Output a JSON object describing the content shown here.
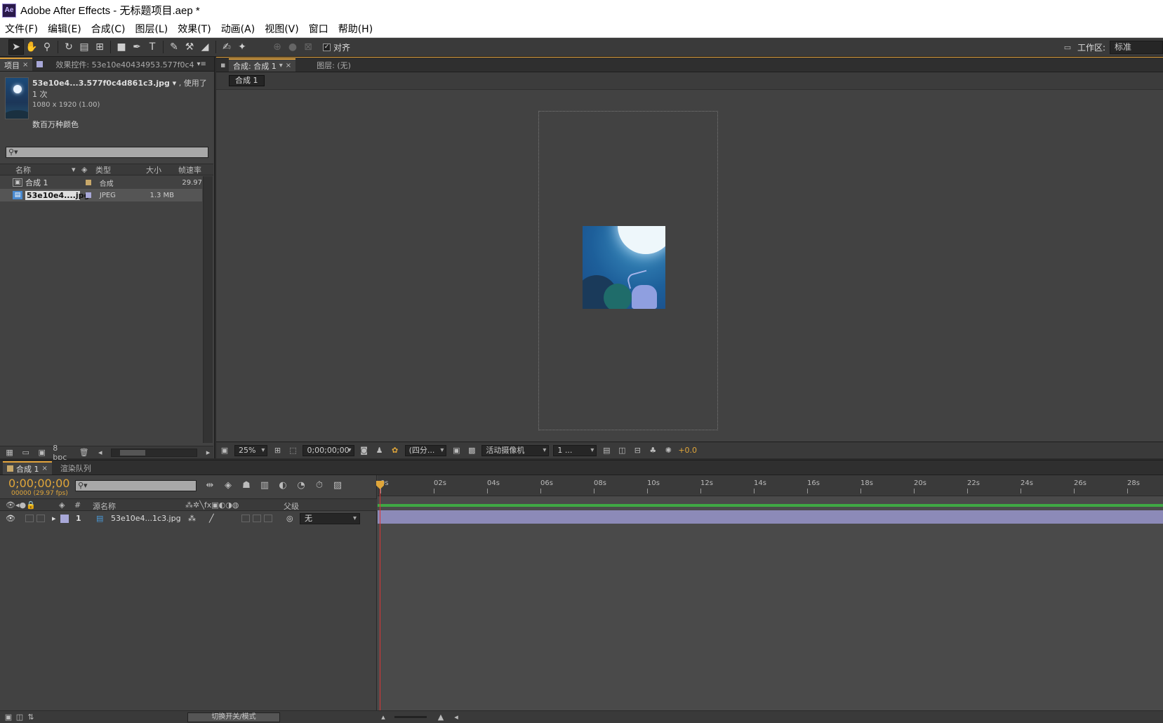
{
  "window": {
    "title": "Adobe After Effects - 无标题项目.aep *",
    "logo_text": "Ae"
  },
  "menu": [
    "文件(F)",
    "编辑(E)",
    "合成(C)",
    "图层(L)",
    "效果(T)",
    "动画(A)",
    "视图(V)",
    "窗口",
    "帮助(H)"
  ],
  "toolbar": {
    "align_label": "对齐",
    "align_checked": "✓",
    "workspace_label": "工作区:",
    "workspace_value": "标准"
  },
  "project_panel": {
    "tab_project": "项目",
    "tab_effects": "效果控件: 53e10e40434953.577f0c4",
    "file_name": "53e10e4...3.577f0c4d861c3.jpg ▾",
    "usage": ", 使用了 1 次",
    "dimensions": "1080 x 1920 (1.00)",
    "color_info": "数百万种颜色",
    "columns": {
      "name": "名称",
      "type": "类型",
      "size": "大小",
      "fps": "帧速率"
    },
    "items": [
      {
        "name": "合成 1",
        "type": "合成",
        "size": "",
        "fps": "29.97",
        "label_color": "#c8a86a"
      },
      {
        "name": "53e10e4....jpg",
        "type": "JPEG",
        "size": "1.3 MB",
        "fps": "",
        "label_color": "#a8a8d8"
      }
    ],
    "bpc": "8 bpc"
  },
  "comp_panel": {
    "tab_comp": "合成: 合成 1",
    "tab_layer": "图层: (无)",
    "breadcrumb": "合成 1",
    "zoom": "25%",
    "timecode": "0;00;00;00",
    "resolution": "(四分...",
    "camera": "活动摄像机",
    "views": "1 ...",
    "exposure": "+0.0"
  },
  "timeline": {
    "tab_comp": "合成 1",
    "tab_render": "渲染队列",
    "timecode": "0;00;00;00",
    "fps_line": "00000 (29.97 fps)",
    "headers": {
      "index": "#",
      "source": "源名称",
      "parent": "父级"
    },
    "layer": {
      "index": "1",
      "name": "53e10e4...1c3.jpg",
      "parent": "无"
    },
    "ruler": [
      "0s",
      "02s",
      "04s",
      "06s",
      "08s",
      "10s",
      "12s",
      "14s",
      "16s",
      "18s",
      "20s",
      "22s",
      "24s",
      "26s",
      "28s"
    ],
    "toggle_label": "切换开关/模式"
  },
  "colors": {
    "accent": "#e0a63a",
    "panel": "#424242",
    "layer_bar": "#8c8ab8",
    "work_area": "#3fa844",
    "playhead": "#dd3333"
  }
}
